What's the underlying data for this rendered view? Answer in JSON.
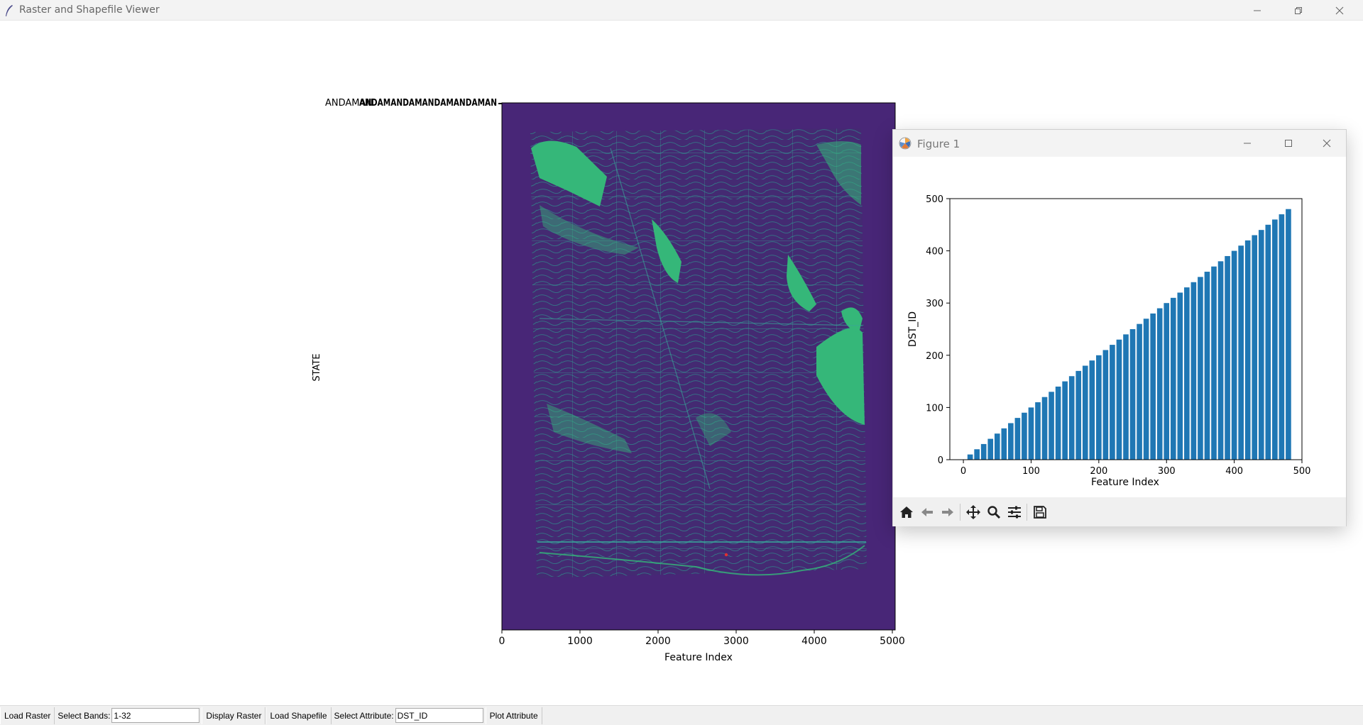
{
  "window": {
    "title": "Raster and Shapefile Viewer"
  },
  "main_plot": {
    "ylabel": "STATE",
    "xlabel": "Feature Index",
    "x_ticks": [
      "0",
      "1000",
      "2000",
      "3000",
      "4000",
      "5000"
    ],
    "top_left_text": "ANDAMAN",
    "overlapping_text": "ANDAMANDAMANDAMANDAMAN"
  },
  "figure_window": {
    "title": "Figure 1",
    "toolbar_icons": [
      "home-icon",
      "back-icon",
      "forward-icon",
      "pan-icon",
      "zoom-icon",
      "configure-icon",
      "save-icon"
    ]
  },
  "chart_data": {
    "type": "bar",
    "xlabel": "Feature Index",
    "ylabel": "DST_ID",
    "xlim": [
      -20,
      500
    ],
    "ylim": [
      0,
      500
    ],
    "x_ticks": [
      0,
      100,
      200,
      300,
      400,
      500
    ],
    "y_ticks": [
      0,
      100,
      200,
      300,
      400,
      500
    ],
    "bar_width": 8,
    "x": [
      10,
      20,
      30,
      40,
      50,
      60,
      70,
      80,
      90,
      100,
      110,
      120,
      130,
      140,
      150,
      160,
      170,
      180,
      190,
      200,
      210,
      220,
      230,
      240,
      250,
      260,
      270,
      280,
      290,
      300,
      310,
      320,
      330,
      340,
      350,
      360,
      370,
      380,
      390,
      400,
      410,
      420,
      430,
      440,
      450,
      460,
      470,
      480
    ],
    "values": [
      10,
      20,
      30,
      40,
      50,
      60,
      70,
      80,
      90,
      100,
      110,
      120,
      130,
      140,
      150,
      160,
      170,
      180,
      190,
      200,
      210,
      220,
      230,
      240,
      250,
      260,
      270,
      280,
      290,
      300,
      310,
      320,
      330,
      340,
      350,
      360,
      370,
      380,
      390,
      400,
      410,
      420,
      430,
      440,
      450,
      460,
      470,
      480
    ],
    "bar_color": "#1f77b4",
    "grid": false
  },
  "bottom_bar": {
    "load_raster": "Load Raster",
    "select_bands_label": "Select Bands:",
    "select_bands_value": "1-32",
    "display_raster": "Display Raster",
    "load_shapefile": "Load Shapefile",
    "select_attribute_label": "Select Attribute:",
    "select_attribute_value": "DST_ID",
    "plot_attribute": "Plot Attribute"
  },
  "colors": {
    "map_background": "#482677",
    "map_lines": "#2f8a8c",
    "map_highlight": "#35b779",
    "marker": "#e03030"
  }
}
